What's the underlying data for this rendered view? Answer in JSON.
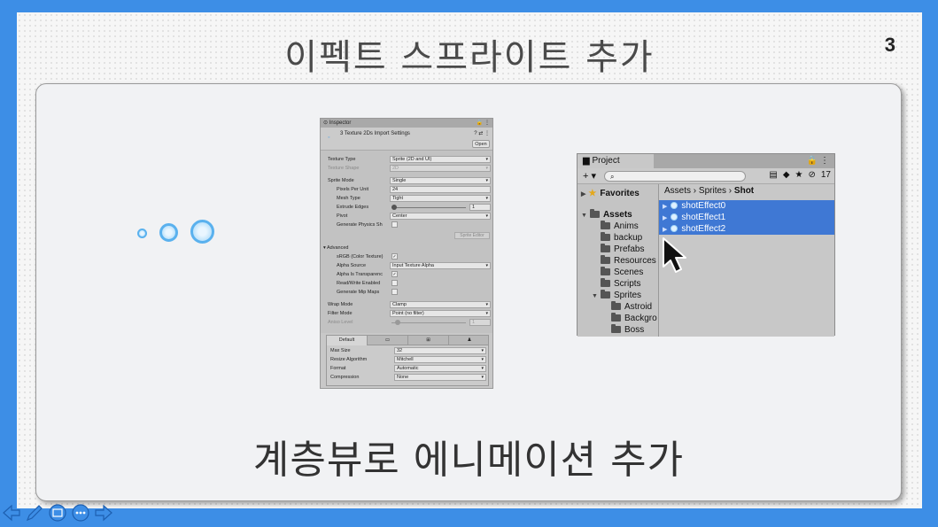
{
  "slide": {
    "title": "이펙트 스프라이트 추가",
    "page_number": "3",
    "bottom_text": "계층뷰로 에니메이션 추가"
  },
  "inspector": {
    "tab_label": "Inspector",
    "header_title": "3 Texture 2Ds Import Settings",
    "open_button": "Open",
    "rows": {
      "texture_type": {
        "label": "Texture Type",
        "value": "Sprite (2D and UI)"
      },
      "texture_shape": {
        "label": "Texture Shape",
        "value": "2D"
      },
      "sprite_mode": {
        "label": "Sprite Mode",
        "value": "Single"
      },
      "pixels_per_unit": {
        "label": "Pixels Per Unit",
        "value": "24"
      },
      "mesh_type": {
        "label": "Mesh Type",
        "value": "Tight"
      },
      "extrude_edges": {
        "label": "Extrude Edges",
        "value": "1"
      },
      "pivot": {
        "label": "Pivot",
        "value": "Center"
      },
      "generate_physics": {
        "label": "Generate Physics Sh"
      },
      "sprite_editor": "Sprite Editor",
      "advanced": "Advanced",
      "srgb": {
        "label": "sRGB (Color Texture)",
        "value": "✓"
      },
      "alpha_source": {
        "label": "Alpha Source",
        "value": "Input Texture Alpha"
      },
      "alpha_transparency": {
        "label": "Alpha Is Transparenc",
        "value": "✓"
      },
      "read_write": {
        "label": "Read/Write Enabled"
      },
      "mip_maps": {
        "label": "Generate Mip Maps"
      },
      "wrap_mode": {
        "label": "Wrap Mode",
        "value": "Clamp"
      },
      "filter_mode": {
        "label": "Filter Mode",
        "value": "Point (no filter)"
      },
      "aniso_level": {
        "label": "Aniso Level",
        "value": "1"
      }
    },
    "platform_tabs": [
      "Default",
      "▭",
      "⊞",
      "♟"
    ],
    "platform": {
      "max_size": {
        "label": "Max Size",
        "value": "32"
      },
      "resize": {
        "label": "Resize Algorithm",
        "value": "Mitchell"
      },
      "format": {
        "label": "Format",
        "value": "Automatic"
      },
      "compression": {
        "label": "Compression",
        "value": "None"
      }
    }
  },
  "project": {
    "tab_label": "Project",
    "hidden_count": "17",
    "search_placeholder": "",
    "tree": {
      "favorites": "Favorites",
      "assets": "Assets",
      "folders": [
        "Anims",
        "backup",
        "Prefabs",
        "Resources",
        "Scenes",
        "Scripts"
      ],
      "sprites": "Sprites",
      "sprite_folders": [
        "Astroid",
        "Backgro",
        "Boss"
      ]
    },
    "breadcrumb": {
      "assets": "Assets",
      "sprites": "Sprites",
      "shot": "Shot"
    },
    "files": [
      "shotEffect0",
      "shotEffect1",
      "shotEffect2"
    ]
  },
  "colors": {
    "frame_blue": "#3d8ee6",
    "selection_blue": "#3f78d4",
    "bubble_blue": "#5ab1ee"
  }
}
